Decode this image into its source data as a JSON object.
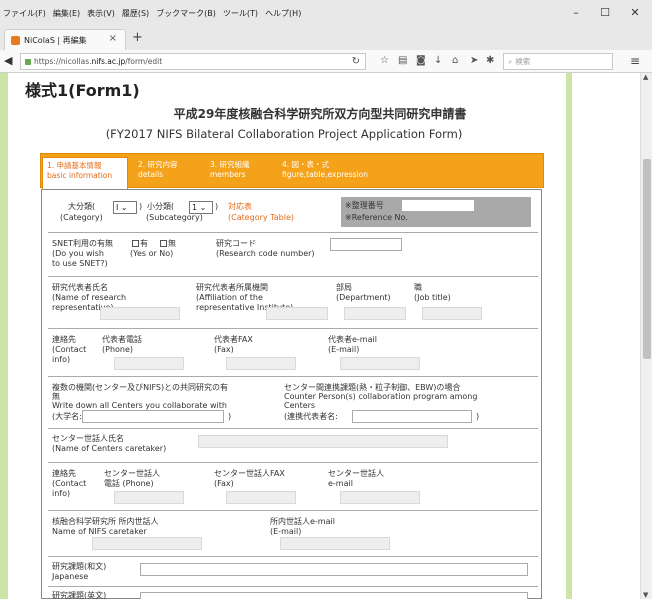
{
  "menu": [
    "ファイル(F)",
    "編集(E)",
    "表示(V)",
    "履歴(S)",
    "ブックマーク(B)",
    "ツール(T)",
    "ヘルプ(H)"
  ],
  "window": {
    "minimize": "–",
    "maximize": "☐",
    "close": "✕"
  },
  "tab": {
    "title": "NiColaS | 再編集",
    "close": "×",
    "new": "+"
  },
  "url": {
    "prefix": "https://nicollas.",
    "host": "nifs.ac.jp",
    "path": "/form/edit"
  },
  "search": {
    "placeholder": "検索"
  },
  "page": {
    "form_heading": "様式1(Form1)",
    "title_ja": "平成29年度核融合科学研究所双方向型共同研究申請書",
    "title_en": "(FY2017 NIFS Bilateral Collaboration Project Application Form)"
  },
  "steps": [
    {
      "ja": "1. 申請基本情報",
      "en": "basic information"
    },
    {
      "ja": "2. 研究内容",
      "en": "details"
    },
    {
      "ja": "3. 研究組織",
      "en": "members"
    },
    {
      "ja": "4. 図・表・式",
      "en": "figure,table,expression"
    }
  ],
  "form": {
    "category": {
      "ja": "大分類(",
      "en": "(Category)",
      "close": ")",
      "value": "I"
    },
    "subcategory": {
      "ja": "小分類(",
      "en": "(Subcategory)",
      "close": ")",
      "value": "1"
    },
    "category_table": {
      "ja": "対応表",
      "en": "(Category Table)"
    },
    "reference": {
      "ja": "※整理番号",
      "en": "※Reference No."
    },
    "snet": {
      "ja": "SNET利用の有無",
      "en1": "(Do you wish",
      "en2": "to use SNET?)",
      "yes": "有",
      "no": "無",
      "yn": "(Yes or No)"
    },
    "research_code": {
      "ja": "研究コード",
      "en": "(Research code number)"
    },
    "rep_name": {
      "ja": "研究代表者氏名",
      "en1": "(Name of research",
      "en2": "representative)"
    },
    "rep_affil": {
      "ja": "研究代表者所属機関",
      "en1": "(Affiliation of the",
      "en2": "representative Institute)"
    },
    "department": {
      "ja": "部局",
      "en": "(Department)"
    },
    "job_title": {
      "ja": "職",
      "en": "(Job title)"
    },
    "contact": {
      "ja": "連絡先",
      "en1": "(Contact",
      "en2": "info)"
    },
    "rep_phone": {
      "ja": "代表者電話",
      "en": "(Phone)"
    },
    "rep_fax": {
      "ja": "代表者FAX",
      "en": "(Fax)"
    },
    "rep_email": {
      "ja": "代表者e-mail",
      "en": "(E-mail)"
    },
    "joint": {
      "line1": "複数の機関(センター及びNIFS)との共同研究の有",
      "line2": "無",
      "line3": "Write down all Centers you collaborate with",
      "uni": "(大学名:",
      "uni_close": ")"
    },
    "center": {
      "line1": "センター間連携課題(熱・粒子制御、EBW)の場合",
      "line2": "Counter Person(s) collaboration program among",
      "line3": "Centers",
      "rep": "(連携代表者名:",
      "rep_close": ")"
    },
    "caretaker": {
      "ja": "センター世話人氏名",
      "en": "(Name of Centers caretaker)"
    },
    "contact2": {
      "ja": "連絡先",
      "en1": "(Contact",
      "en2": "info)"
    },
    "ct_phone": {
      "ja1": "センター世話人",
      "ja2": "電話",
      "en": "(Phone)"
    },
    "ct_fax": {
      "ja": "センター世話人FAX",
      "en": "(Fax)"
    },
    "ct_email": {
      "ja": "センター世話人",
      "en": "e-mail"
    },
    "nifs_caretaker": {
      "ja": "核融合科学研究所 所内世話人",
      "en": "Name of NIFS caretaker"
    },
    "nifs_email": {
      "ja": "所内世話人e-mail",
      "en": "(E-mail)"
    },
    "title_ja_field": {
      "ja": "研究課題(和文)",
      "en": "Japanese"
    },
    "title_en_field": {
      "ja": "研究課題(英文)"
    }
  }
}
